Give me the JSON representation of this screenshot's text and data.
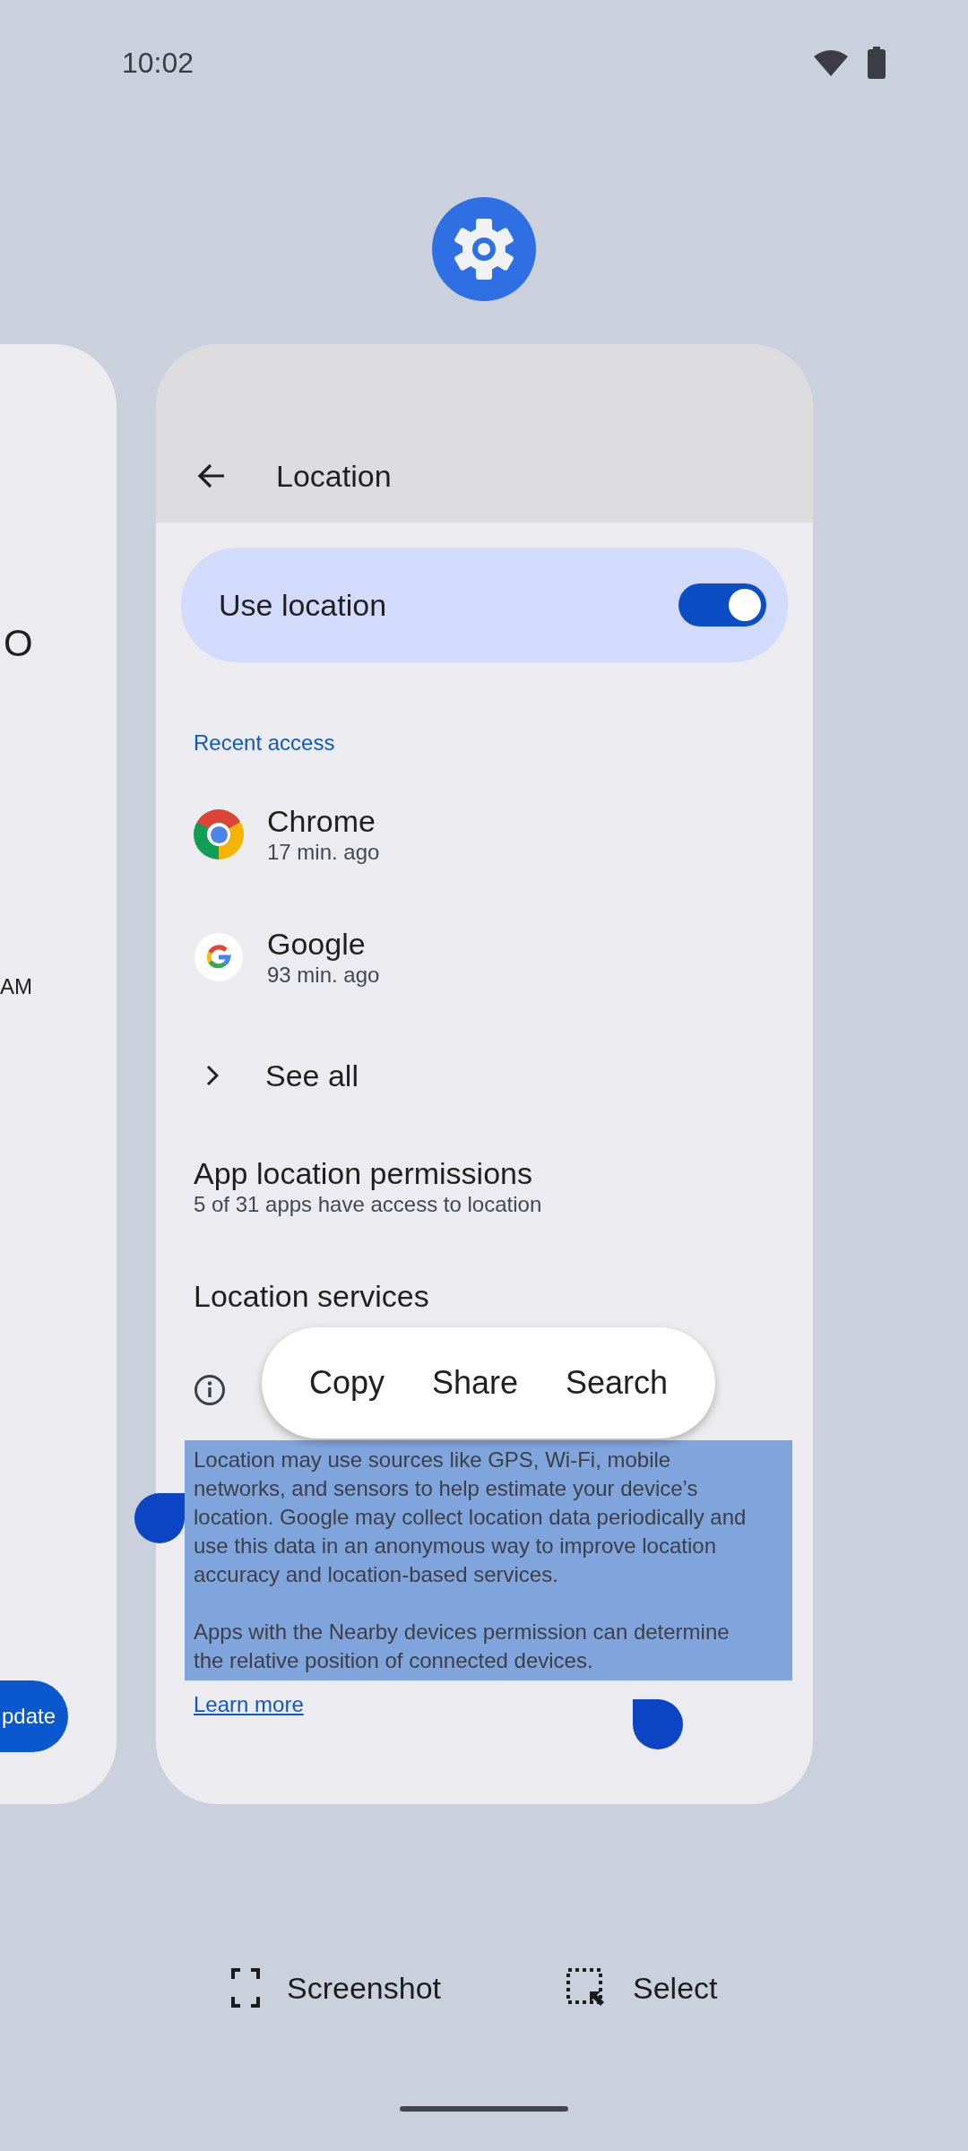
{
  "status_bar": {
    "time": "10:02"
  },
  "left_card": {
    "heading": "O",
    "time": "AM",
    "button": "pdate"
  },
  "app_card": {
    "title": "Location",
    "use_location": {
      "label": "Use location",
      "on": true
    },
    "section": "Recent access",
    "recent_apps": [
      {
        "name": "Chrome",
        "time": "17 min. ago",
        "kind": "chrome"
      },
      {
        "name": "Google",
        "time": "93 min. ago",
        "kind": "google"
      }
    ],
    "see_all": "See all",
    "permissions": {
      "title": "App location permissions",
      "subtitle": "5 of 31 apps have access to location"
    },
    "services_title": "Location services",
    "description": {
      "selected": true,
      "paragraphs": [
        "Location may use sources like GPS, Wi-Fi, mobile networks, and sensors to help estimate your device’s location. Google may collect location data periodically and use this data in an anonymous way to improve location accuracy and location-based services.",
        "Apps with the Nearby devices permission can determine the relative position of connected devices."
      ]
    },
    "learn_more": "Learn more"
  },
  "text_menu": [
    "Copy",
    "Share",
    "Search"
  ],
  "actions": [
    {
      "label": "Screenshot",
      "kind": "screenshot"
    },
    {
      "label": "Select",
      "kind": "select"
    }
  ]
}
